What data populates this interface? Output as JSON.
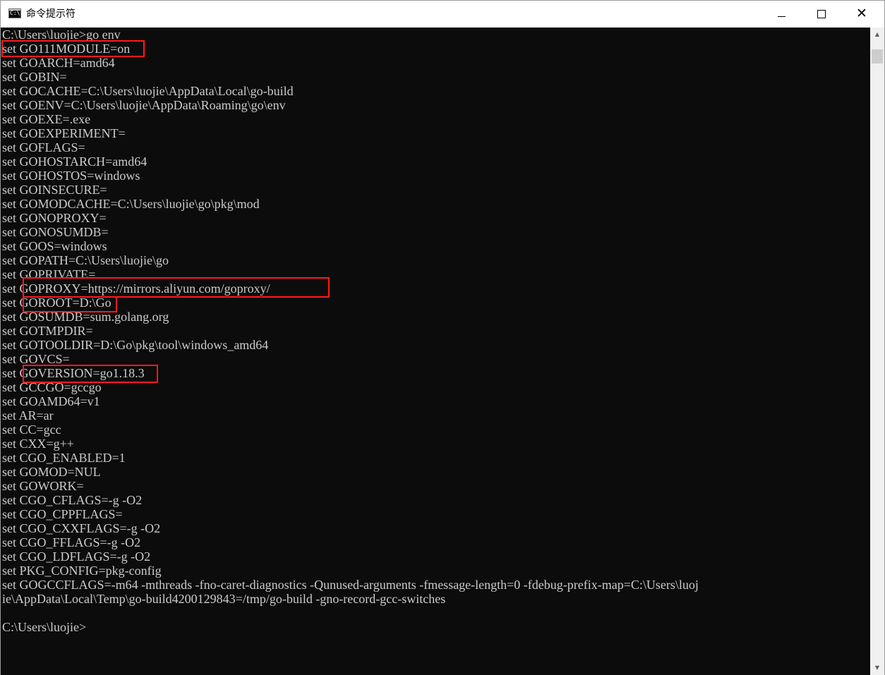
{
  "window": {
    "title": "命令提示符",
    "app_icon_text": "C:\\",
    "min_glyph": "",
    "close_glyph": "✕"
  },
  "console": {
    "lines": [
      "C:\\Users\\luojie>go env",
      "set GO111MODULE=on",
      "set GOARCH=amd64",
      "set GOBIN=",
      "set GOCACHE=C:\\Users\\luojie\\AppData\\Local\\go-build",
      "set GOENV=C:\\Users\\luojie\\AppData\\Roaming\\go\\env",
      "set GOEXE=.exe",
      "set GOEXPERIMENT=",
      "set GOFLAGS=",
      "set GOHOSTARCH=amd64",
      "set GOHOSTOS=windows",
      "set GOINSECURE=",
      "set GOMODCACHE=C:\\Users\\luojie\\go\\pkg\\mod",
      "set GONOPROXY=",
      "set GONOSUMDB=",
      "set GOOS=windows",
      "set GOPATH=C:\\Users\\luojie\\go",
      "set GOPRIVATE=",
      "set GOPROXY=https://mirrors.aliyun.com/goproxy/",
      "set GOROOT=D:\\Go",
      "set GOSUMDB=sum.golang.org",
      "set GOTMPDIR=",
      "set GOTOOLDIR=D:\\Go\\pkg\\tool\\windows_amd64",
      "set GOVCS=",
      "set GOVERSION=go1.18.3",
      "set GCCGO=gccgo",
      "set GOAMD64=v1",
      "set AR=ar",
      "set CC=gcc",
      "set CXX=g++",
      "set CGO_ENABLED=1",
      "set GOMOD=NUL",
      "set GOWORK=",
      "set CGO_CFLAGS=-g -O2",
      "set CGO_CPPFLAGS=",
      "set CGO_CXXFLAGS=-g -O2",
      "set CGO_FFLAGS=-g -O2",
      "set CGO_LDFLAGS=-g -O2",
      "set PKG_CONFIG=pkg-config",
      "set GOGCCFLAGS=-m64 -mthreads -fno-caret-diagnostics -Qunused-arguments -fmessage-length=0 -fdebug-prefix-map=C:\\Users\\luoj",
      "ie\\AppData\\Local\\Temp\\go-build4200129843=/tmp/go-build -gno-record-gcc-switches",
      "",
      "C:\\Users\\luojie>"
    ],
    "text_color": "#cccccc",
    "background_color": "#0c0c0c",
    "highlight_color": "#ff1a1a"
  },
  "scrollbar": {
    "up_glyph": "▲",
    "down_glyph": "▼"
  }
}
